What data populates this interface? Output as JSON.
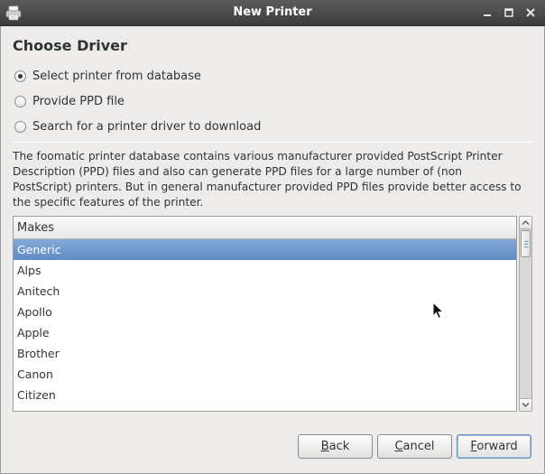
{
  "window": {
    "title": "New Printer",
    "controls": [
      "minimize-icon",
      "maximize-icon",
      "close-icon"
    ]
  },
  "page": {
    "heading": "Choose Driver"
  },
  "options": [
    {
      "label": "Select printer from database",
      "checked": true
    },
    {
      "label": "Provide PPD file",
      "checked": false
    },
    {
      "label": "Search for a printer driver to download",
      "checked": false
    }
  ],
  "description": "The foomatic printer database contains various manufacturer provided PostScript Printer Description (PPD) files and also can generate PPD files for a large number of (non PostScript) printers. But in general manufacturer provided PPD files provide better access to the specific features of the printer.",
  "makes_list": {
    "header": "Makes",
    "items": [
      "Generic",
      "Alps",
      "Anitech",
      "Apollo",
      "Apple",
      "Brother",
      "Canon",
      "Citizen"
    ],
    "selected": "Generic"
  },
  "buttons": {
    "back": {
      "mnemonic": "B",
      "rest": "ack"
    },
    "cancel": {
      "mnemonic": "C",
      "rest": "ancel"
    },
    "forward": {
      "mnemonic": "F",
      "rest": "orward"
    }
  },
  "colors": {
    "titlebar": "#4a4a4a",
    "selection": "#6f97cc",
    "window_bg": "#edeceb"
  }
}
